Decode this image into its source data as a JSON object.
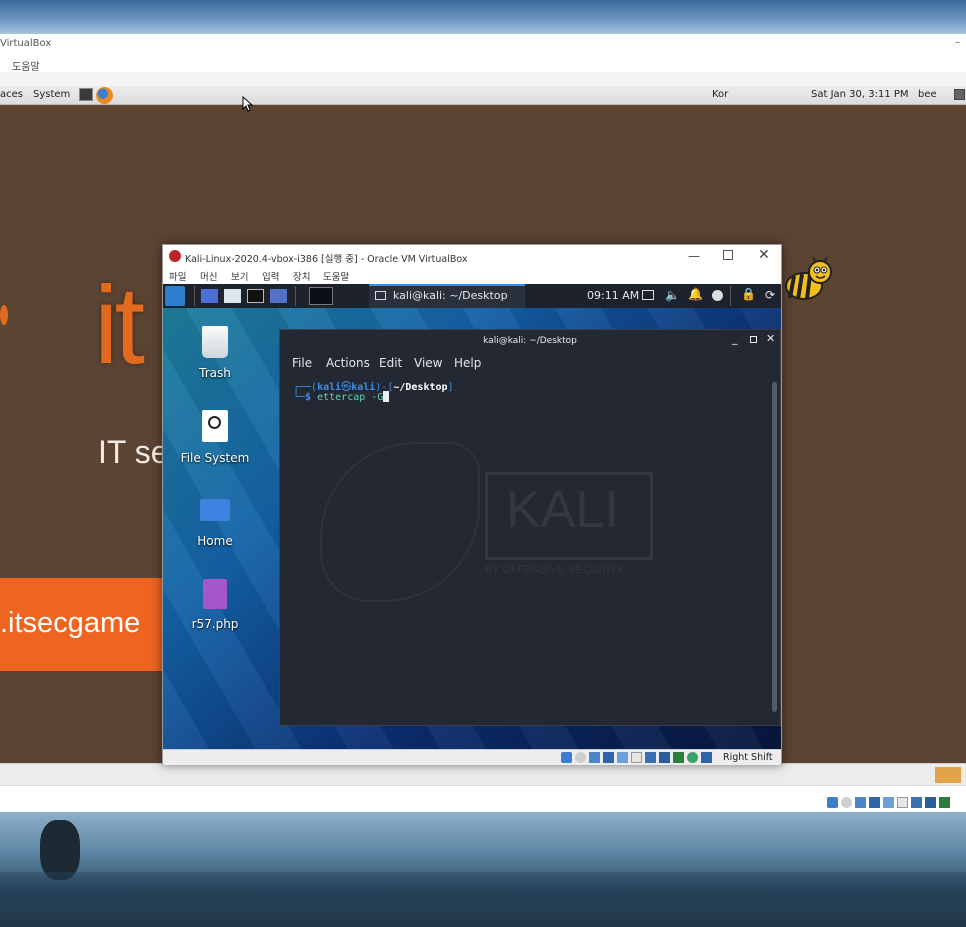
{
  "host": {
    "outer_window_title": "VirtualBox",
    "outer_menu_help": "도움말",
    "outer_min_symbol": "–"
  },
  "gnome_panel": {
    "places": "aces",
    "system": "System",
    "keyboard": "Kor",
    "datetime": "Sat Jan 30,  3:11 PM",
    "user": "bee"
  },
  "bwapp": {
    "logo_text": "it",
    "tagline_partial": "IT se",
    "banner_text": ".itsecgame"
  },
  "inner_vbox": {
    "title": "Kali-Linux-2020.4-vbox-i386 [실행 중] - Oracle VM VirtualBox",
    "menu": [
      "파일",
      "머신",
      "보기",
      "입력",
      "장치",
      "도움말"
    ],
    "status_host_key": "Right Shift"
  },
  "kali_panel": {
    "active_window": "kali@kali: ~/Desktop",
    "clock": "09:11 AM"
  },
  "kali_desktop": {
    "icons": [
      {
        "label": "Trash"
      },
      {
        "label": "File System"
      },
      {
        "label": "Home"
      },
      {
        "label": "r57.php"
      }
    ],
    "watermark_logo": "KALI",
    "watermark_sub": "BY OFFENSIVE SECURITY"
  },
  "terminal": {
    "title": "kali@kali: ~/Desktop",
    "menu": [
      "File",
      "Actions",
      "Edit",
      "View",
      "Help"
    ],
    "prompt_user": "kali",
    "prompt_at": "㉿",
    "prompt_host": "kali",
    "prompt_path": "~/Desktop",
    "command": "ettercap -G"
  },
  "colors": {
    "kali_prompt_blue": "#3b8eea",
    "kali_command_green": "#5fd7af",
    "bwapp_orange": "#ee6420",
    "guest_bg": "#5c4433"
  }
}
